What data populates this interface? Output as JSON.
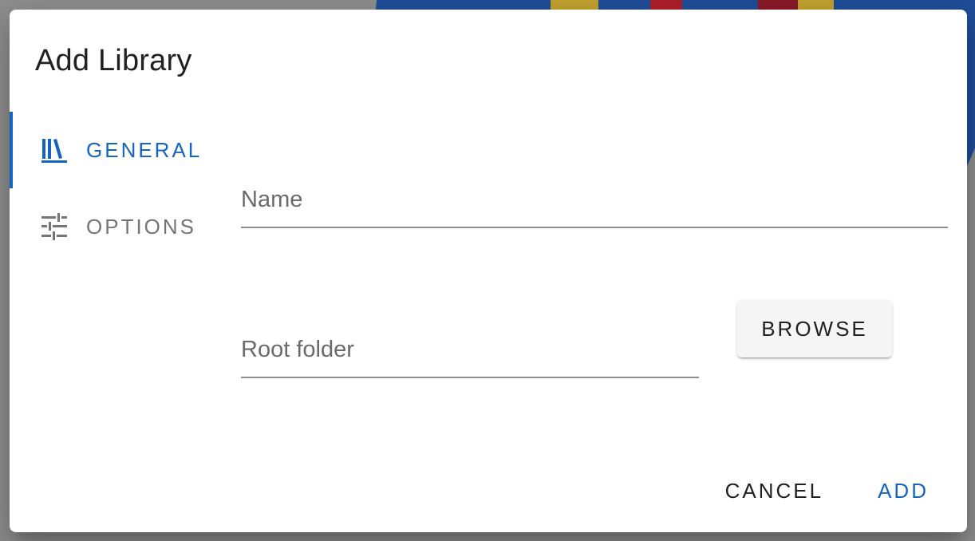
{
  "dialog": {
    "title": "Add Library"
  },
  "tabs": [
    {
      "label": "GENERAL",
      "icon": "library-books-icon",
      "active": true
    },
    {
      "label": "OPTIONS",
      "icon": "tune-icon",
      "active": false
    }
  ],
  "form": {
    "name_label": "Name",
    "name_value": "",
    "root_folder_label": "Root folder",
    "root_folder_value": "",
    "browse_label": "BROWSE"
  },
  "actions": {
    "cancel_label": "CANCEL",
    "add_label": "ADD"
  },
  "colors": {
    "accent": "#1565c0",
    "backdrop": "#8f8f8f"
  }
}
